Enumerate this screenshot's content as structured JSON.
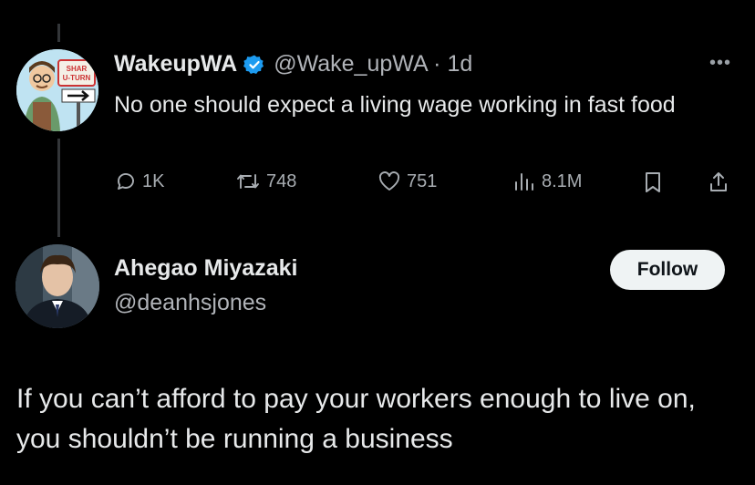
{
  "tweet": {
    "author_name": "WakeupWA",
    "author_handle_time": "@Wake_upWA · 1d",
    "avatar_sign_text": "SHAR U-TURN",
    "text": "No one should expect a living wage working in fast food",
    "more_label": "•••",
    "stats": {
      "replies": "1K",
      "retweets": "748",
      "likes": "751",
      "views": "8.1M"
    }
  },
  "reply": {
    "author_name": "Ahegao Miyazaki",
    "author_handle": "@deanhsjones",
    "follow_label": "Follow",
    "text": "If you can’t afford to pay your workers enough to live on, you shouldn’t be running a business"
  },
  "colors": {
    "background": "#000000",
    "primary_text": "#e7e9ea",
    "secondary_text": "#b0b3b8",
    "verified": "#1d9bf0",
    "follow_button_bg": "#eff3f4"
  }
}
